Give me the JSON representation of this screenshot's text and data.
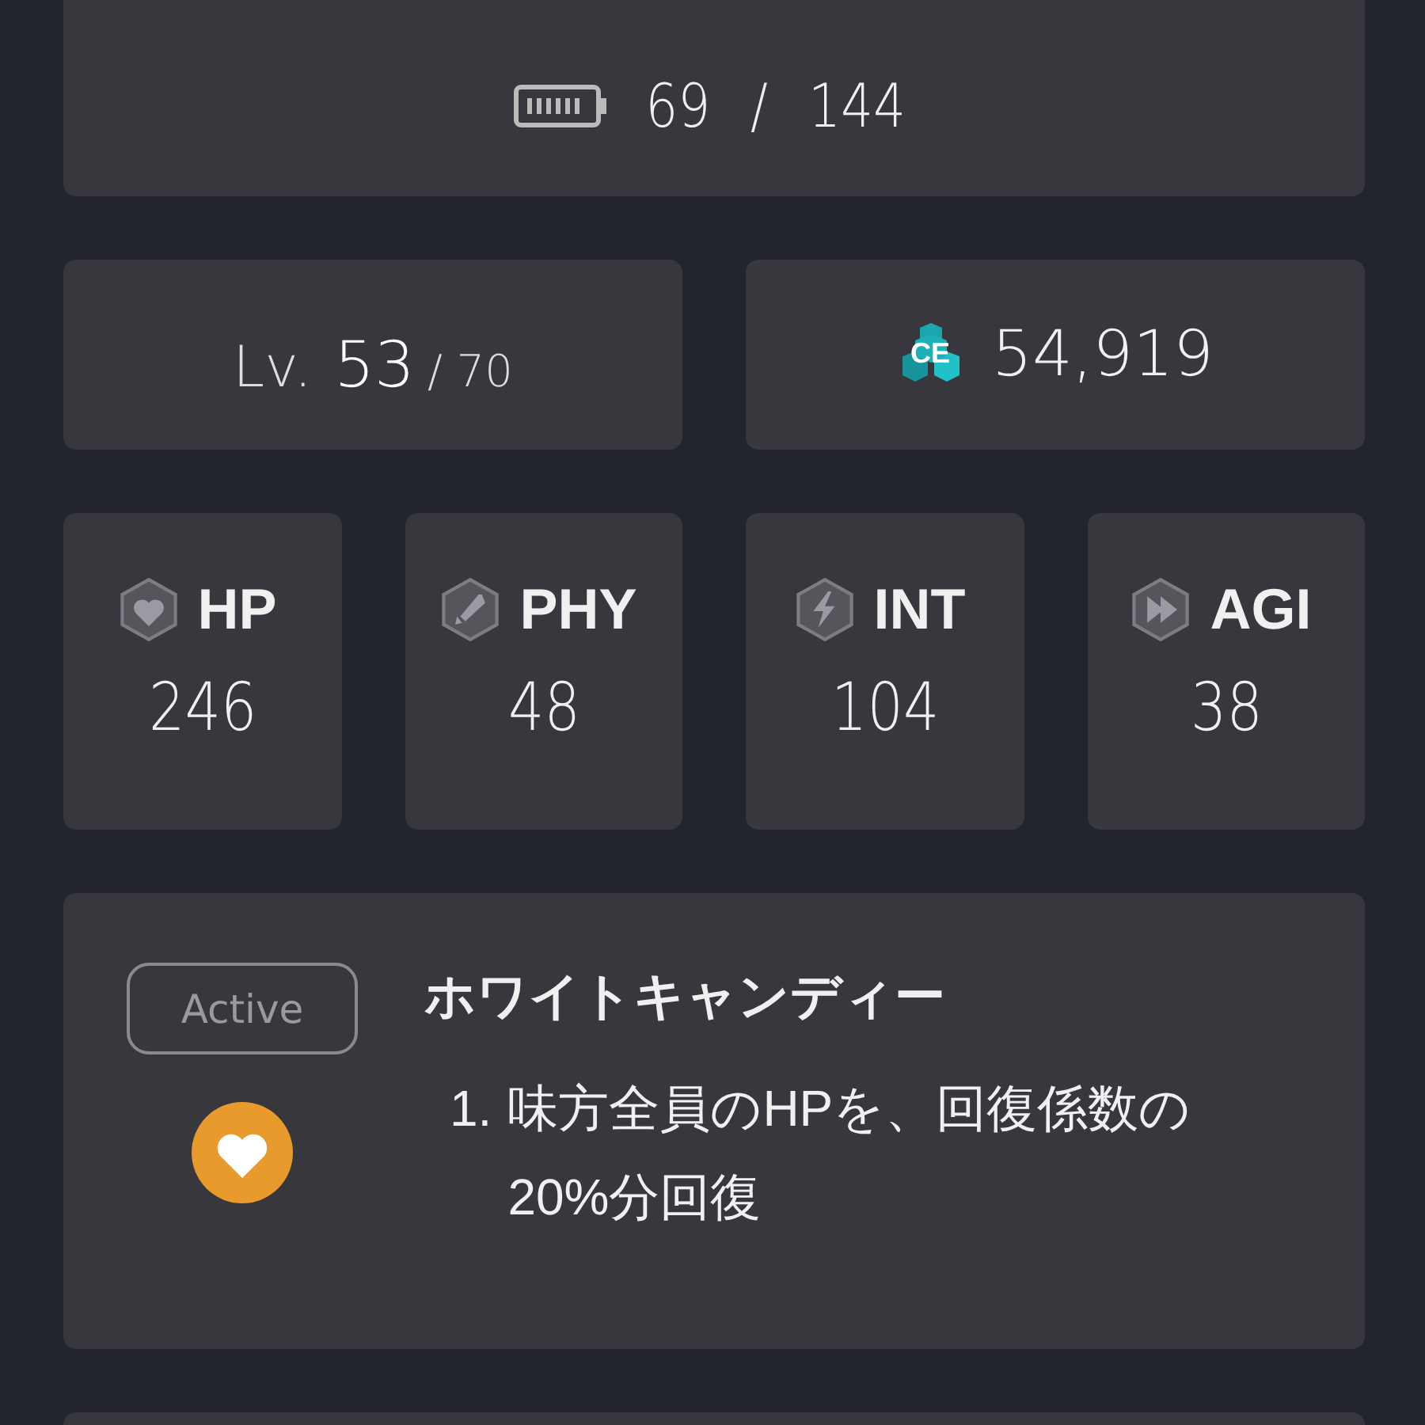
{
  "stamina": {
    "current": "69",
    "separator": "/",
    "max": "144"
  },
  "level": {
    "prefix": "Lv.",
    "current": "53",
    "max": "/ 70"
  },
  "power": {
    "badge": "CE",
    "value": "54,919"
  },
  "stats": [
    {
      "kind": "heart",
      "label": "HP",
      "value": "246"
    },
    {
      "kind": "sword",
      "label": "PHY",
      "value": "48"
    },
    {
      "kind": "bolt",
      "label": "INT",
      "value": "104"
    },
    {
      "kind": "speed",
      "label": "AGI",
      "value": "38"
    }
  ],
  "skill": {
    "type": "Active",
    "kind": "heart",
    "name": "ホワイトキャンディー",
    "effects": [
      {
        "number": "1.",
        "text": "味方全員のHPを、回復係数の20%分回復"
      }
    ]
  }
}
